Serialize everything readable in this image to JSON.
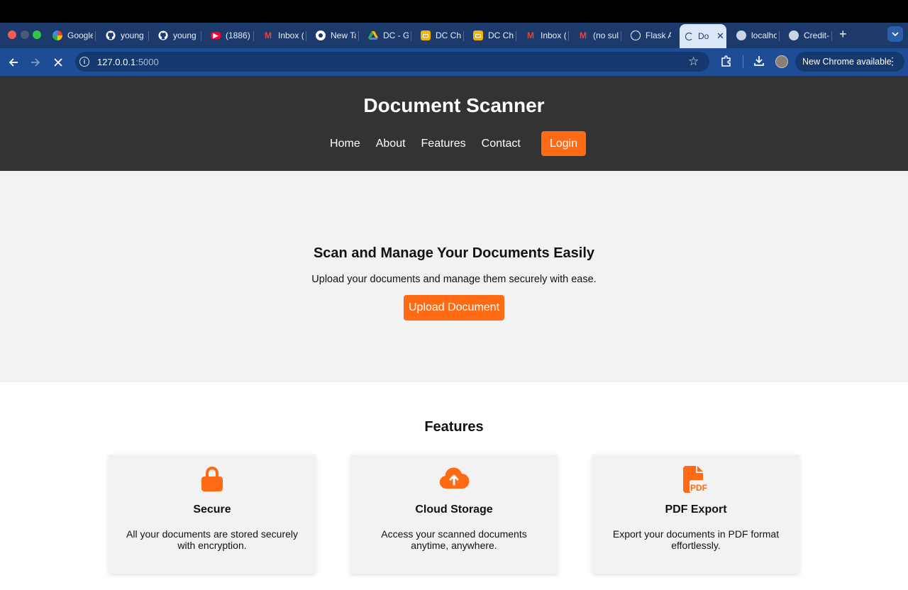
{
  "browser": {
    "tabs": [
      {
        "label": "Google",
        "icon": "google-cloud-icon"
      },
      {
        "label": "young",
        "icon": "github-icon"
      },
      {
        "label": "young",
        "icon": "github-icon"
      },
      {
        "label": "(1886)",
        "icon": "youtube-icon"
      },
      {
        "label": "Inbox (",
        "icon": "gmail-icon"
      },
      {
        "label": "New Ta",
        "icon": "chrome-icon"
      },
      {
        "label": "DC - G",
        "icon": "google-drive-icon"
      },
      {
        "label": "DC Ch",
        "icon": "google-slides-icon"
      },
      {
        "label": "DC Ch",
        "icon": "google-slides-icon"
      },
      {
        "label": "Inbox (",
        "icon": "gmail-icon"
      },
      {
        "label": "(no sul",
        "icon": "gmail-icon"
      },
      {
        "label": "Flask A",
        "icon": "openai-icon"
      },
      {
        "label": "Do",
        "icon": "loading-icon",
        "active": true
      },
      {
        "label": "localho",
        "icon": "globe-icon"
      },
      {
        "label": "Credit-",
        "icon": "globe-icon"
      }
    ],
    "url_host": "127.0.0.1",
    "url_port": ":5000",
    "update_label": "New Chrome available"
  },
  "site": {
    "title": "Document Scanner",
    "nav": {
      "home": "Home",
      "about": "About",
      "features": "Features",
      "contact": "Contact",
      "login": "Login"
    },
    "hero": {
      "title": "Scan and Manage Your Documents Easily",
      "subtitle": "Upload your documents and manage them securely with ease.",
      "button": "Upload Document"
    },
    "features": {
      "title": "Features",
      "cards": [
        {
          "icon": "lock-icon",
          "title": "Secure",
          "desc": "All your documents are stored securely with encryption."
        },
        {
          "icon": "cloud-upload-icon",
          "title": "Cloud Storage",
          "desc": "Access your scanned documents anytime, anywhere."
        },
        {
          "icon": "pdf-file-icon",
          "title": "PDF Export",
          "desc": "Export your documents in PDF format effortlessly."
        }
      ]
    }
  },
  "colors": {
    "accent": "#ff6a14",
    "header_bg": "#333333",
    "hero_bg": "#f2f2f2",
    "browser_frame": "#1f4d95"
  }
}
